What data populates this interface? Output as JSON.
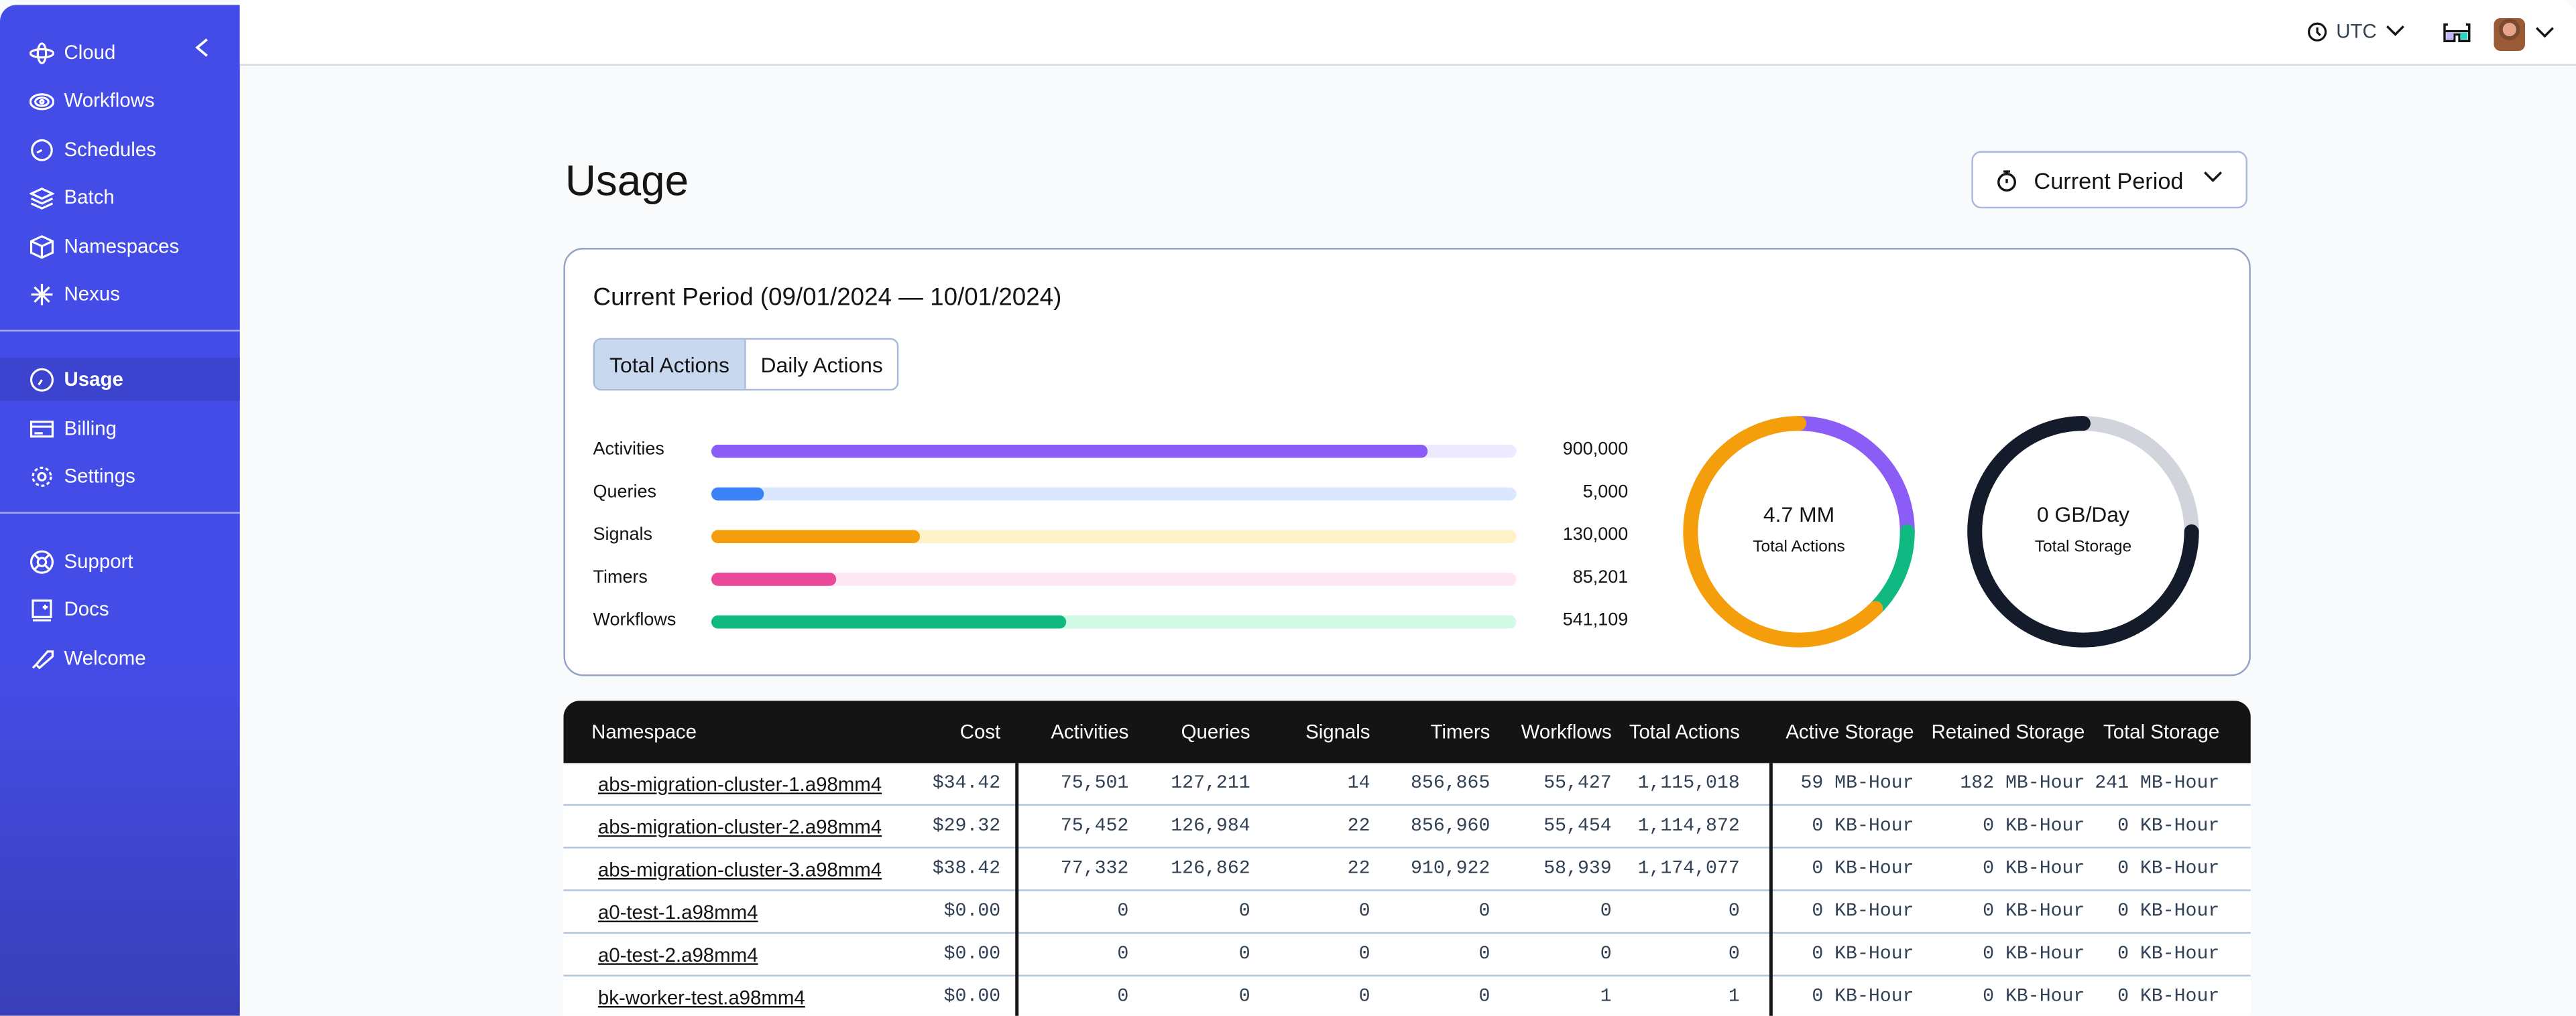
{
  "sidebar": {
    "items": [
      {
        "label": "Cloud",
        "icon": "cloud-orbit-icon"
      },
      {
        "label": "Workflows",
        "icon": "workflows-icon"
      },
      {
        "label": "Schedules",
        "icon": "schedules-icon"
      },
      {
        "label": "Batch",
        "icon": "batch-layers-icon"
      },
      {
        "label": "Namespaces",
        "icon": "namespaces-cube-icon"
      },
      {
        "label": "Nexus",
        "icon": "nexus-asterisk-icon"
      },
      {
        "label": "Usage",
        "icon": "usage-gauge-icon",
        "active": true
      },
      {
        "label": "Billing",
        "icon": "billing-card-icon"
      },
      {
        "label": "Settings",
        "icon": "settings-gear-icon"
      },
      {
        "label": "Support",
        "icon": "support-lifebuoy-icon"
      },
      {
        "label": "Docs",
        "icon": "docs-icon"
      },
      {
        "label": "Welcome",
        "icon": "welcome-rocket-icon"
      }
    ]
  },
  "topbar": {
    "timezone": "UTC"
  },
  "page": {
    "title": "Usage",
    "period_button": "Current Period"
  },
  "card": {
    "title": "Current Period (09/01/2024 — 10/01/2024)",
    "tabs": [
      "Total Actions",
      "Daily Actions"
    ],
    "active_tab": "Total Actions",
    "bars": [
      {
        "label": "Activities",
        "value": "900,000",
        "fill": 0.89,
        "color": "#8b5cf6",
        "track": "#ede9fe"
      },
      {
        "label": "Queries",
        "value": "5,000",
        "fill": 0.065,
        "color": "#3b82f6",
        "track": "#dbe7fe"
      },
      {
        "label": "Signals",
        "value": "130,000",
        "fill": 0.26,
        "color": "#f59e0b",
        "track": "#fef3c7"
      },
      {
        "label": "Timers",
        "value": "85,201",
        "fill": 0.155,
        "color": "#ec4899",
        "track": "#fce7f3"
      },
      {
        "label": "Workflows",
        "value": "541,109",
        "fill": 0.44,
        "color": "#10b981",
        "track": "#d1fae5"
      }
    ],
    "actions_donut": {
      "value": "4.7 MM",
      "label": "Total Actions",
      "segments": [
        {
          "color": "#8b5cf6",
          "fraction": 0.25
        },
        {
          "color": "#10b981",
          "fraction": 0.125
        },
        {
          "color": "#f59e0b",
          "fraction": 0.625
        }
      ]
    },
    "storage_donut": {
      "value": "0 GB/Day",
      "label": "Total Storage",
      "track": "#d1d5db",
      "segments": [
        {
          "color": "#d1d5db",
          "fraction": 0.25
        },
        {
          "color": "#141b2b",
          "fraction": 0.75
        }
      ]
    }
  },
  "table": {
    "columns": [
      "Namespace",
      "Cost",
      "Activities",
      "Queries",
      "Signals",
      "Timers",
      "Workflows",
      "Total Actions",
      "Active Storage",
      "Retained Storage",
      "Total Storage"
    ],
    "rows": [
      [
        "abs-migration-cluster-1.a98mm4",
        "$34.42",
        "75,501",
        "127,211",
        "14",
        "856,865",
        "55,427",
        "1,115,018",
        "59 MB-Hour",
        "182 MB-Hour",
        "241 MB-Hour"
      ],
      [
        "abs-migration-cluster-2.a98mm4",
        "$29.32",
        "75,452",
        "126,984",
        "22",
        "856,960",
        "55,454",
        "1,114,872",
        "0 KB-Hour",
        "0 KB-Hour",
        "0 KB-Hour"
      ],
      [
        "abs-migration-cluster-3.a98mm4",
        "$38.42",
        "77,332",
        "126,862",
        "22",
        "910,922",
        "58,939",
        "1,174,077",
        "0 KB-Hour",
        "0 KB-Hour",
        "0 KB-Hour"
      ],
      [
        "a0-test-1.a98mm4",
        "$0.00",
        "0",
        "0",
        "0",
        "0",
        "0",
        "0",
        "0 KB-Hour",
        "0 KB-Hour",
        "0 KB-Hour"
      ],
      [
        "a0-test-2.a98mm4",
        "$0.00",
        "0",
        "0",
        "0",
        "0",
        "0",
        "0",
        "0 KB-Hour",
        "0 KB-Hour",
        "0 KB-Hour"
      ],
      [
        "bk-worker-test.a98mm4",
        "$0.00",
        "0",
        "0",
        "0",
        "0",
        "1",
        "1",
        "0 KB-Hour",
        "0 KB-Hour",
        "0 KB-Hour"
      ]
    ]
  }
}
